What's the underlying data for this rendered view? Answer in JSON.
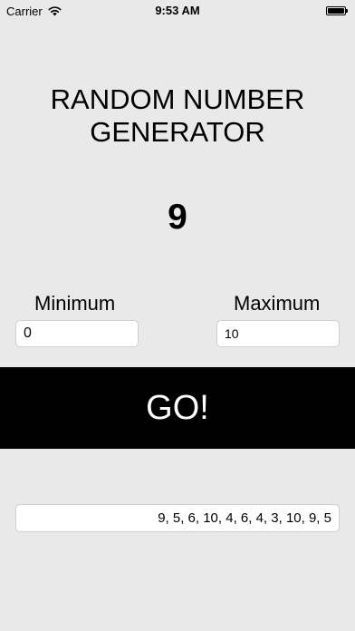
{
  "status_bar": {
    "carrier": "Carrier",
    "time": "9:53 AM",
    "battery_level": 1.0
  },
  "title": "RANDOM NUMBER GENERATOR",
  "result": "9",
  "minimum": {
    "label": "Minimum",
    "value": "0"
  },
  "maximum": {
    "label": "Maximum",
    "value": "10"
  },
  "go_label": "GO!",
  "history": "9, 5, 6, 10, 4, 6, 4, 3, 10, 9, 5",
  "icons": {
    "wifi": "wifi-icon",
    "battery": "battery-icon"
  }
}
